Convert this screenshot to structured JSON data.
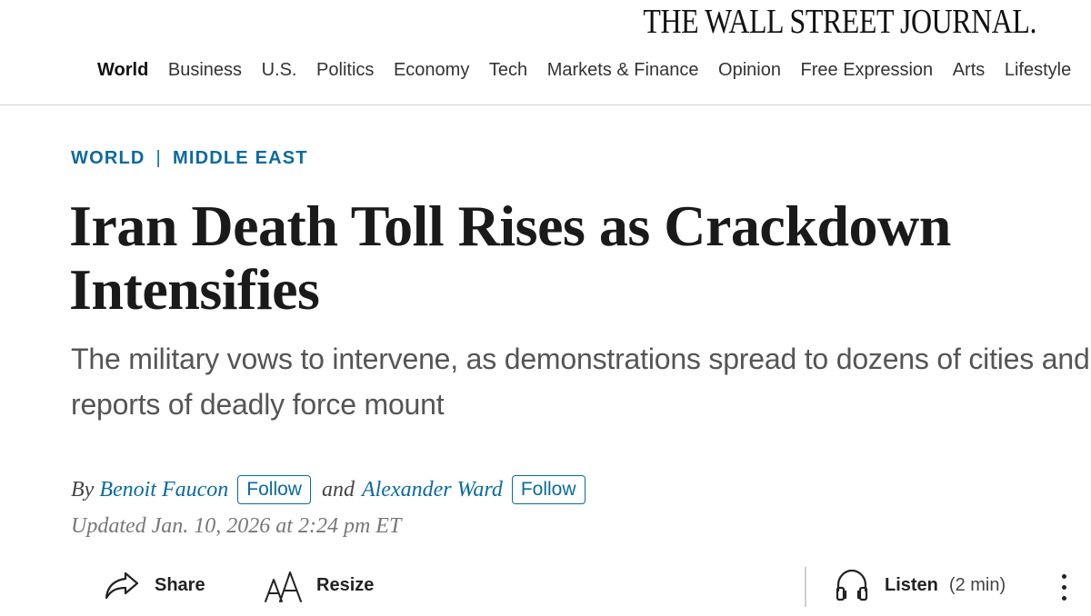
{
  "masthead": {
    "title": "THE WALL STREET JOURNAL."
  },
  "nav": {
    "items": [
      {
        "label": "World",
        "active": true
      },
      {
        "label": "Business"
      },
      {
        "label": "U.S."
      },
      {
        "label": "Politics"
      },
      {
        "label": "Economy"
      },
      {
        "label": "Tech"
      },
      {
        "label": "Markets & Finance"
      },
      {
        "label": "Opinion"
      },
      {
        "label": "Free Expression"
      },
      {
        "label": "Arts"
      },
      {
        "label": "Lifestyle"
      }
    ]
  },
  "article": {
    "section": "WORLD",
    "section_separator": "|",
    "subsection": "MIDDLE EAST",
    "headline": "Iran Death Toll Rises as Crackdown Intensifies",
    "dek": "The military vows to intervene, as demonstrations spread to dozens of cities and reports of deadly force mount",
    "byline": {
      "by": "By",
      "author1": "Benoit Faucon",
      "and": "and",
      "author2": "Alexander Ward",
      "follow_label": "Follow"
    },
    "updated": "Updated Jan. 10, 2026 at 2:24 pm ET"
  },
  "toolbar": {
    "share_label": "Share",
    "share_icon": "share-arrow-icon",
    "resize_label": "Resize",
    "resize_icon": "text-size-icon",
    "listen_label": "Listen",
    "listen_icon": "headphones-icon",
    "listen_duration": "(2 min)",
    "more_icon": "vertical-ellipsis-icon"
  },
  "colors": {
    "accent": "#0a6aa1",
    "headline": "#1a1a1a",
    "dek": "#555555",
    "muted": "#777777"
  }
}
